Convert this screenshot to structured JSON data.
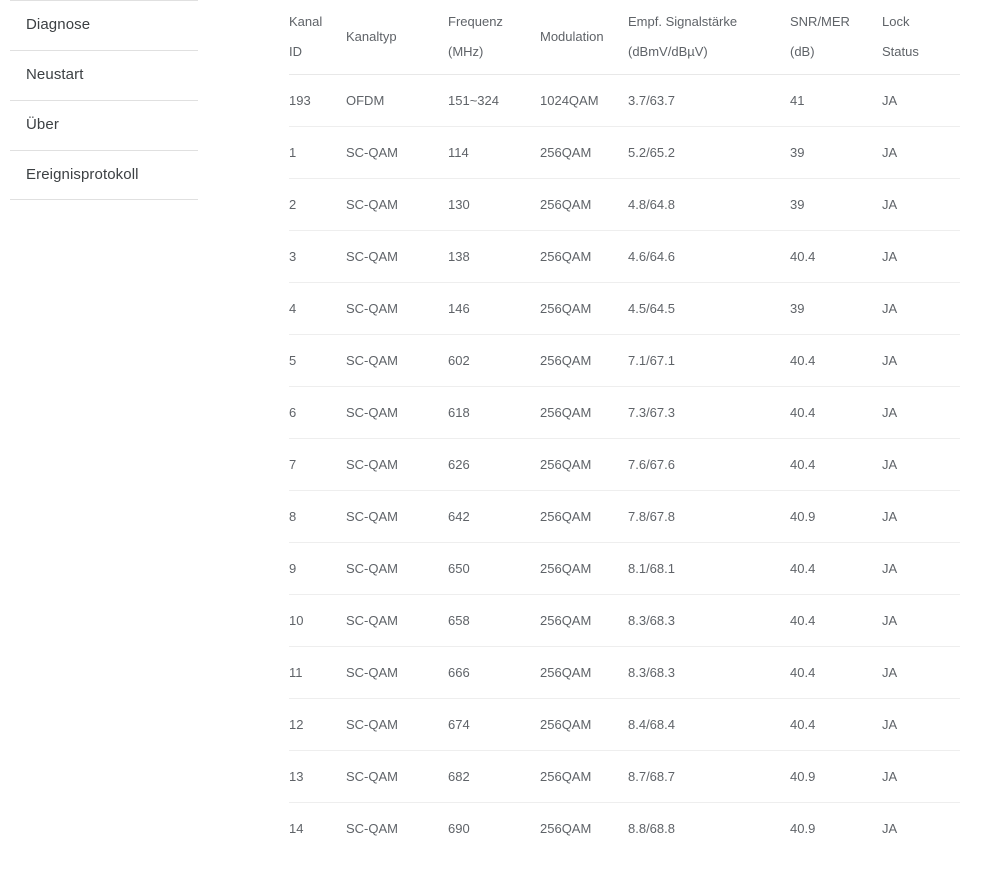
{
  "sidebar": {
    "items": [
      {
        "label": "Diagnose",
        "name": "sidebar-item-diagnose"
      },
      {
        "label": "Neustart",
        "name": "sidebar-item-neustart"
      },
      {
        "label": "Über",
        "name": "sidebar-item-ueber"
      },
      {
        "label": "Ereignisprotokoll",
        "name": "sidebar-item-ereignisprotokoll"
      }
    ]
  },
  "table": {
    "columns": [
      {
        "key": "id",
        "line1": "Kanal",
        "line2": "ID"
      },
      {
        "key": "type",
        "line1": "Kanaltyp",
        "line2": ""
      },
      {
        "key": "freq",
        "line1": "Frequenz",
        "line2": "(MHz)"
      },
      {
        "key": "mod",
        "line1": "Modulation",
        "line2": ""
      },
      {
        "key": "power",
        "line1": "Empf. Signalstärke",
        "line2": "(dBmV/dBµV)"
      },
      {
        "key": "snr",
        "line1": "SNR/MER",
        "line2": "(dB)"
      },
      {
        "key": "lock",
        "line1": "Lock",
        "line2": "Status"
      }
    ],
    "rows": [
      {
        "id": "193",
        "type": "OFDM",
        "freq": "151~324",
        "mod": "1024QAM",
        "power": "3.7/63.7",
        "snr": "41",
        "lock": "JA"
      },
      {
        "id": "1",
        "type": "SC-QAM",
        "freq": "114",
        "mod": "256QAM",
        "power": "5.2/65.2",
        "snr": "39",
        "lock": "JA"
      },
      {
        "id": "2",
        "type": "SC-QAM",
        "freq": "130",
        "mod": "256QAM",
        "power": "4.8/64.8",
        "snr": "39",
        "lock": "JA"
      },
      {
        "id": "3",
        "type": "SC-QAM",
        "freq": "138",
        "mod": "256QAM",
        "power": "4.6/64.6",
        "snr": "40.4",
        "lock": "JA"
      },
      {
        "id": "4",
        "type": "SC-QAM",
        "freq": "146",
        "mod": "256QAM",
        "power": "4.5/64.5",
        "snr": "39",
        "lock": "JA"
      },
      {
        "id": "5",
        "type": "SC-QAM",
        "freq": "602",
        "mod": "256QAM",
        "power": "7.1/67.1",
        "snr": "40.4",
        "lock": "JA"
      },
      {
        "id": "6",
        "type": "SC-QAM",
        "freq": "618",
        "mod": "256QAM",
        "power": "7.3/67.3",
        "snr": "40.4",
        "lock": "JA"
      },
      {
        "id": "7",
        "type": "SC-QAM",
        "freq": "626",
        "mod": "256QAM",
        "power": "7.6/67.6",
        "snr": "40.4",
        "lock": "JA"
      },
      {
        "id": "8",
        "type": "SC-QAM",
        "freq": "642",
        "mod": "256QAM",
        "power": "7.8/67.8",
        "snr": "40.9",
        "lock": "JA"
      },
      {
        "id": "9",
        "type": "SC-QAM",
        "freq": "650",
        "mod": "256QAM",
        "power": "8.1/68.1",
        "snr": "40.4",
        "lock": "JA"
      },
      {
        "id": "10",
        "type": "SC-QAM",
        "freq": "658",
        "mod": "256QAM",
        "power": "8.3/68.3",
        "snr": "40.4",
        "lock": "JA"
      },
      {
        "id": "11",
        "type": "SC-QAM",
        "freq": "666",
        "mod": "256QAM",
        "power": "8.3/68.3",
        "snr": "40.4",
        "lock": "JA"
      },
      {
        "id": "12",
        "type": "SC-QAM",
        "freq": "674",
        "mod": "256QAM",
        "power": "8.4/68.4",
        "snr": "40.4",
        "lock": "JA"
      },
      {
        "id": "13",
        "type": "SC-QAM",
        "freq": "682",
        "mod": "256QAM",
        "power": "8.7/68.7",
        "snr": "40.9",
        "lock": "JA"
      },
      {
        "id": "14",
        "type": "SC-QAM",
        "freq": "690",
        "mod": "256QAM",
        "power": "8.8/68.8",
        "snr": "40.9",
        "lock": "JA"
      }
    ]
  },
  "colors": {
    "page_background": "#ffffff",
    "nav_text": "#3c4043",
    "nav_divider": "#e0e0e0",
    "table_text": "#5f6368",
    "table_divider": "#eeeeee",
    "header_divider": "#e8e8e8"
  }
}
